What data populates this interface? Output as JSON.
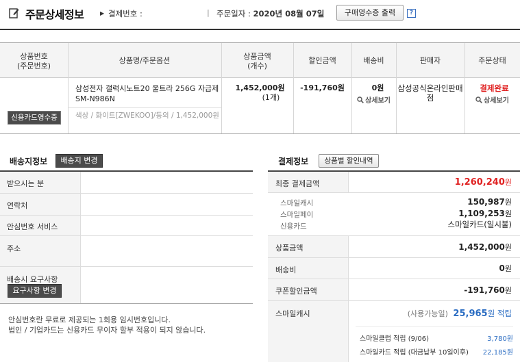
{
  "header": {
    "title": "주문상세정보",
    "payment_no_label": "결제번호 :",
    "payment_no_value": "",
    "order_date_label": "주문일자 :",
    "order_date_value": "2020년 08월 07일",
    "receipt_button": "구매영수증 출력",
    "help_icon": "?"
  },
  "product_table": {
    "columns": [
      {
        "line1": "상품번호",
        "line2": "(주문번호)"
      },
      {
        "line1": "상품명/주문옵션",
        "line2": ""
      },
      {
        "line1": "상품금액",
        "line2": "(개수)"
      },
      {
        "line1": "할인금액",
        "line2": ""
      },
      {
        "line1": "배송비",
        "line2": ""
      },
      {
        "line1": "판매자",
        "line2": ""
      },
      {
        "line1": "주문상태",
        "line2": ""
      }
    ],
    "row": {
      "card_receipt_button": "신용카드영수증",
      "name": "삼성전자 갤럭시노트20 울트라 256G 자급제 SM-N986N",
      "option": "색상 / 화이트[ZWEKOO]/등의 / 1,452,000원",
      "price": "1,452,000원",
      "qty": "(1개)",
      "discount": "-191,760원",
      "shipping": "0원",
      "shipping_detail": "상세보기",
      "seller": "삼성공식온라인판매점",
      "status": "결제완료",
      "status_detail": "상세보기"
    }
  },
  "shipping": {
    "title": "배송지정보",
    "change_button": "배송지 변경",
    "rows": [
      {
        "label": "받으시는 분",
        "value": ""
      },
      {
        "label": "연락처",
        "value": ""
      },
      {
        "label": "안심번호 서비스",
        "value": ""
      },
      {
        "label": "주소",
        "value": ""
      },
      {
        "label": "배송시 요구사항",
        "value": ""
      }
    ],
    "request_button": "요구사항 변경",
    "notes": [
      "안심번호란 무료로 제공되는 1회용 임시번호입니다.",
      "법인 / 기업카드는 신용카드 무이자 할부 적용이 되지 않습니다."
    ]
  },
  "payment": {
    "title": "결제정보",
    "discount_detail_button": "상품별 할인내역",
    "final_label": "최종 결제금액",
    "final_amount": "1,260,240",
    "won": "원",
    "methods": [
      {
        "label": "스마일캐시",
        "amount": "150,987",
        "unit": "원"
      },
      {
        "label": "스마일페이",
        "amount": "1,109,253",
        "unit": "원"
      },
      {
        "label": "신용카드",
        "amount": "스마일카드(일시불)",
        "unit": ""
      }
    ],
    "product_amount_label": "상품금액",
    "product_amount": "1,452,000",
    "shipping_label": "배송비",
    "shipping_amount": "0",
    "coupon_label": "쿠폰할인금액",
    "coupon_amount": "-191,760",
    "smilecash_label": "스마일캐시",
    "available_label": "(사용가능일)",
    "earn_amount": "25,965",
    "earn_suffix": "원 적립",
    "earn_rows": [
      {
        "label": "스마일클럽 적립 (9/06)",
        "amount": "3,780원"
      },
      {
        "label": "스마일카드 적립 (대금납부 10일이후)",
        "amount": "22,185원"
      }
    ]
  },
  "colors": {
    "accent_red": "#e02222",
    "accent_blue": "#2a6cc2",
    "dark_button": "#4b4b4b"
  }
}
